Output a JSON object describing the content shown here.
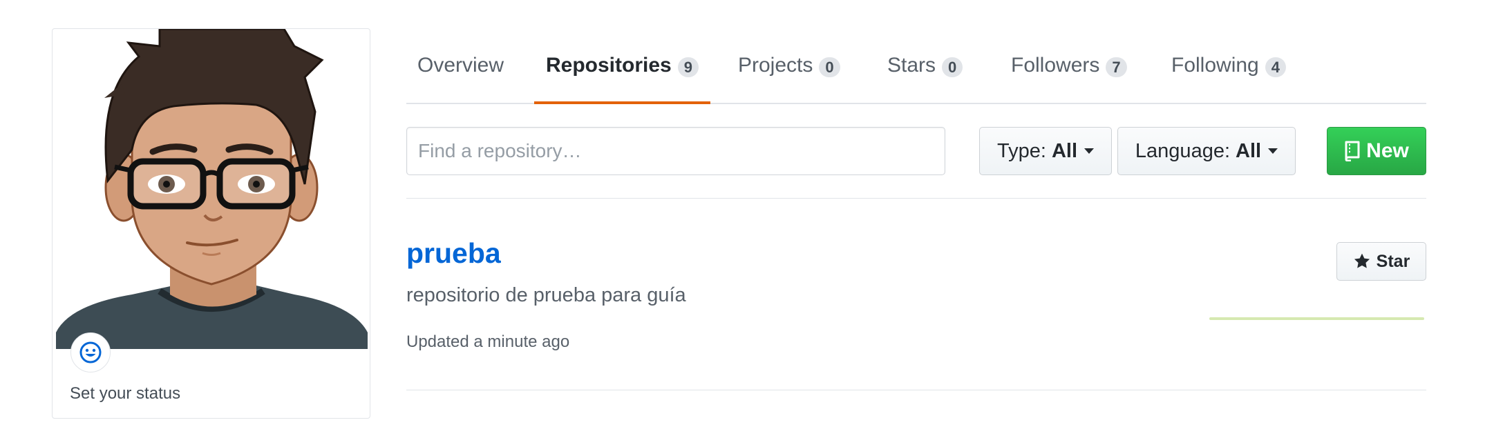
{
  "profile": {
    "status_text": "Set your status",
    "status_icon": "smiley-icon"
  },
  "tabs": [
    {
      "label": "Overview",
      "count": null,
      "selected": false
    },
    {
      "label": "Repositories",
      "count": "9",
      "selected": true
    },
    {
      "label": "Projects",
      "count": "0",
      "selected": false
    },
    {
      "label": "Stars",
      "count": "0",
      "selected": false
    },
    {
      "label": "Followers",
      "count": "7",
      "selected": false
    },
    {
      "label": "Following",
      "count": "4",
      "selected": false
    }
  ],
  "filters": {
    "search_placeholder": "Find a repository…",
    "type_label": "Type:",
    "type_value": "All",
    "language_label": "Language:",
    "language_value": "All",
    "new_label": "New"
  },
  "repository": {
    "name": "prueba",
    "description": "repositorio de prueba para guía",
    "updated": "Updated a minute ago",
    "star_label": "Star"
  },
  "colors": {
    "accent_tab_underline": "#e36209",
    "link": "#0366d6",
    "new_button": "#28a745",
    "sparkline": "#d6e9b1"
  }
}
